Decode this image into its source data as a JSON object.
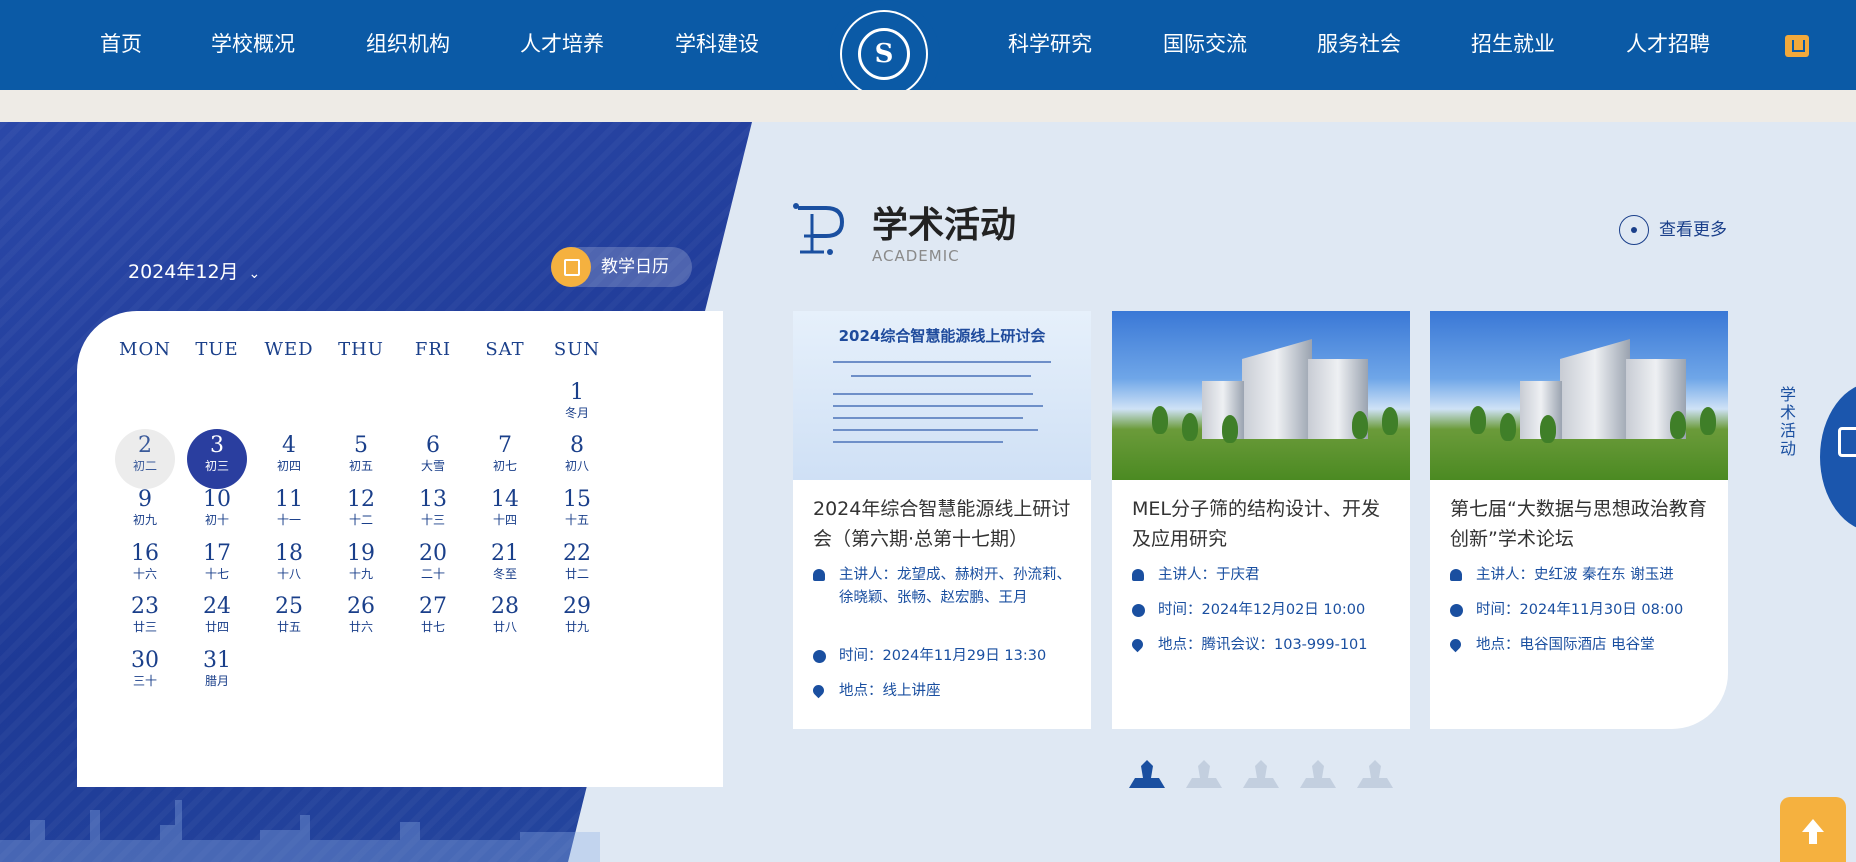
{
  "nav": {
    "items_left": [
      "首页",
      "学校概况",
      "组织机构",
      "人才培养",
      "学科建设"
    ],
    "items_right": [
      "科学研究",
      "国际交流",
      "服务社会",
      "招生就业",
      "人才招聘"
    ],
    "logo_text": "S"
  },
  "calendar": {
    "month_label": "2024年12月",
    "teaching_calendar_label": "教学日历",
    "weekdays": [
      "MON",
      "TUE",
      "WED",
      "THU",
      "FRI",
      "SAT",
      "SUN"
    ],
    "days": [
      {
        "d": "1",
        "l": "冬月"
      },
      {
        "d": "2",
        "l": "初二"
      },
      {
        "d": "3",
        "l": "初三"
      },
      {
        "d": "4",
        "l": "初四"
      },
      {
        "d": "5",
        "l": "初五"
      },
      {
        "d": "6",
        "l": "大雪"
      },
      {
        "d": "7",
        "l": "初七"
      },
      {
        "d": "8",
        "l": "初八"
      },
      {
        "d": "9",
        "l": "初九"
      },
      {
        "d": "10",
        "l": "初十"
      },
      {
        "d": "11",
        "l": "十一"
      },
      {
        "d": "12",
        "l": "十二"
      },
      {
        "d": "13",
        "l": "十三"
      },
      {
        "d": "14",
        "l": "十四"
      },
      {
        "d": "15",
        "l": "十五"
      },
      {
        "d": "16",
        "l": "十六"
      },
      {
        "d": "17",
        "l": "十七"
      },
      {
        "d": "18",
        "l": "十八"
      },
      {
        "d": "19",
        "l": "十九"
      },
      {
        "d": "20",
        "l": "二十"
      },
      {
        "d": "21",
        "l": "冬至"
      },
      {
        "d": "22",
        "l": "廿二"
      },
      {
        "d": "23",
        "l": "廿三"
      },
      {
        "d": "24",
        "l": "廿四"
      },
      {
        "d": "25",
        "l": "廿五"
      },
      {
        "d": "26",
        "l": "廿六"
      },
      {
        "d": "27",
        "l": "廿七"
      },
      {
        "d": "28",
        "l": "廿八"
      },
      {
        "d": "29",
        "l": "廿九"
      },
      {
        "d": "30",
        "l": "三十"
      },
      {
        "d": "31",
        "l": "腊月"
      }
    ],
    "first_weekday_index": 6,
    "today": "3",
    "highlighted": "2"
  },
  "academic": {
    "title": "学术活动",
    "subtitle": "ACADEMIC",
    "more_label": "查看更多",
    "side_label": "学术活动",
    "cards": [
      {
        "poster_title": "2024综合智慧能源线上研讨会",
        "title": "2024年综合智慧能源线上研讨会（第六期·总第十七期）",
        "host_label": "主讲人：",
        "host": "龙望成、赫树开、孙流莉、徐晓颖、张畅、赵宏鹏、王月",
        "time_label": "时间：",
        "time": "2024年11月29日 13:30",
        "place_label": "地点：",
        "place": "线上讲座"
      },
      {
        "title": "MEL分子筛的结构设计、开发及应用研究",
        "host_label": "主讲人：",
        "host": "于庆君",
        "time_label": "时间：",
        "time": "2024年12月02日 10:00",
        "place_label": "地点：",
        "place": "腾讯会议：103-999-101"
      },
      {
        "title": "第七届“大数据与思想政治教育创新”学术论坛",
        "host_label": "主讲人：",
        "host": "史红波 秦在东 谢玉进",
        "time_label": "时间：",
        "time": "2024年11月30日 08:00",
        "place_label": "地点：",
        "place": "电谷国际酒店 电谷堂"
      }
    ],
    "pager_count": 5,
    "pager_active": 0
  },
  "colors": {
    "nav_bg": "#0b5aa6",
    "accent_orange": "#f5b13f",
    "text_blue": "#1a4fa0"
  },
  "icons": {
    "nav_badge": "calendar-book-icon",
    "teaching_calendar": "calendar-icon",
    "more": "target-circle-icon",
    "host": "person-icon",
    "time": "clock-icon",
    "place": "location-pin-icon",
    "back_to_top": "arrow-up-icon"
  }
}
